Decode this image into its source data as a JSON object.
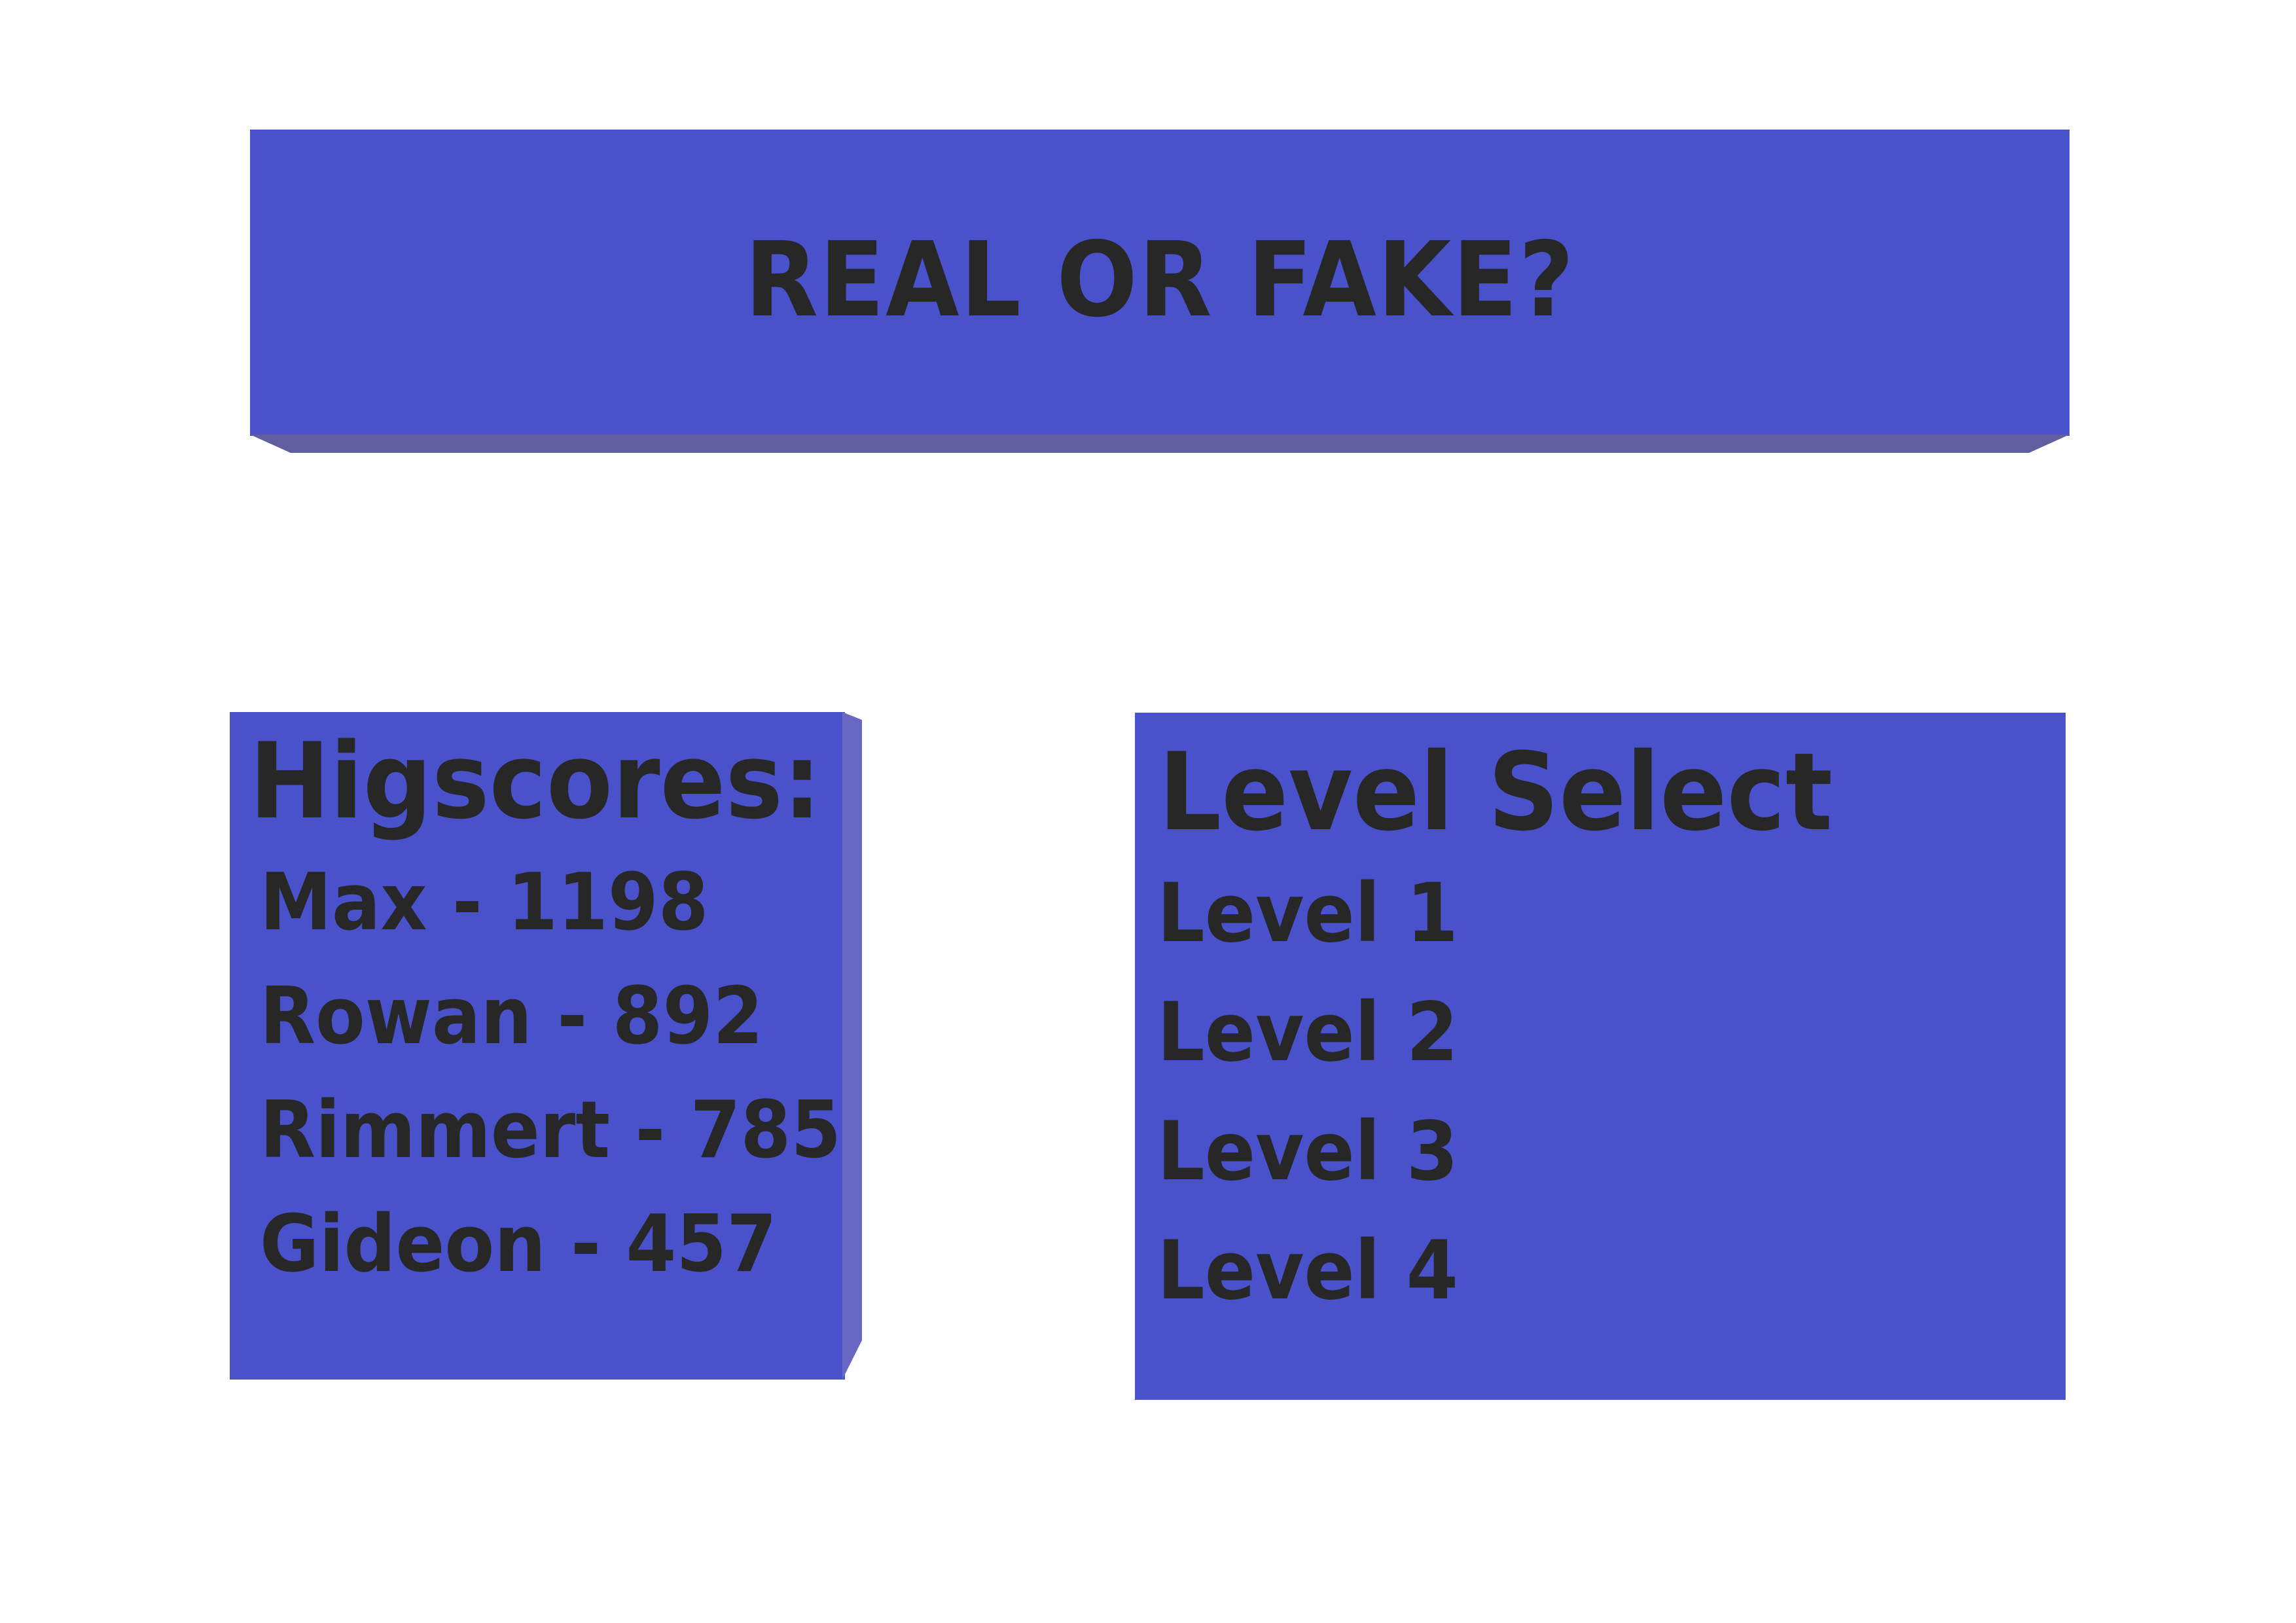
{
  "title": {
    "text": "REAL OR FAKE?"
  },
  "highscores": {
    "heading": "Higscores:",
    "entries": [
      "Max - 1198",
      "Rowan - 892",
      "Rimmert - 785",
      "Gideon - 457"
    ]
  },
  "level_select": {
    "heading": "Level Select",
    "levels": [
      "Level 1",
      "Level 2",
      "Level 3",
      "Level 4"
    ]
  },
  "colors": {
    "panel": "#4a52cb",
    "panel_edge": "#5f5f9f",
    "text": "#272727",
    "background": "#ffffff"
  }
}
